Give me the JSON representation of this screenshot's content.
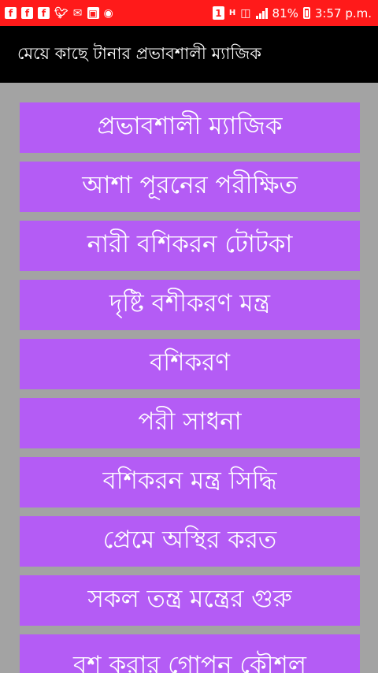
{
  "status_bar": {
    "notification_count": "1",
    "network_type": "H",
    "battery_percent": "81%",
    "time": "3:57 p.m.",
    "icons": [
      "facebook-icon",
      "facebook-icon",
      "facebook-icon",
      "twitter-icon",
      "mail-icon",
      "photo-notification-icon",
      "wifi-icon"
    ]
  },
  "toolbar": {
    "title": "মেয়ে কাছে টানার প্রভাবশালী ম্যাজিক"
  },
  "menu": {
    "items": [
      {
        "label": "প্রভাবশালী ম্যাজিক"
      },
      {
        "label": "আশা পূরনের পরীক্ষিত"
      },
      {
        "label": "নারী বশিকরন টোটকা"
      },
      {
        "label": "দৃষ্টি বশীকরণ মন্ত্র"
      },
      {
        "label": "বশিকরণ"
      },
      {
        "label": "পরী সাধনা"
      },
      {
        "label": "বশিকরন মন্ত্র সিদ্ধি"
      },
      {
        "label": "প্রেমে অস্থির করত"
      },
      {
        "label": "সকল তন্ত্র মন্ত্রের গুরু"
      },
      {
        "label": "বশ করার গোপন কৌশল"
      }
    ]
  },
  "colors": {
    "status_bar": "#ff1a1a",
    "toolbar": "#000000",
    "background": "#a3a3a3",
    "item": "#b45cf5",
    "item_text": "#ffffff"
  }
}
